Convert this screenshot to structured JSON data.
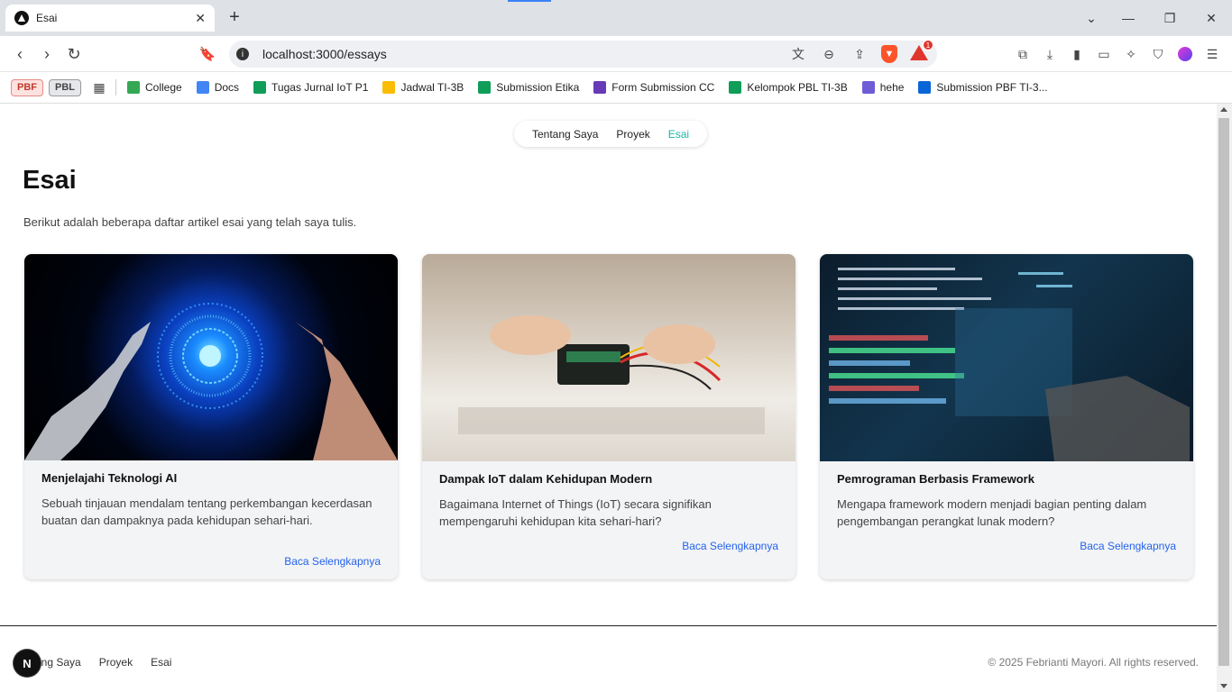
{
  "browser": {
    "tab_title": "Esai",
    "url": "localhost:3000/essays",
    "bookmarks": [
      {
        "label": "College",
        "icon": "google-drive-icon",
        "color": "#34a853"
      },
      {
        "label": "Docs",
        "icon": "google-docs-icon",
        "color": "#4285f4"
      },
      {
        "label": "Tugas Jurnal IoT P1",
        "icon": "google-sheets-icon",
        "color": "#0f9d58"
      },
      {
        "label": "Jadwal TI-3B",
        "icon": "google-drive-icon",
        "color": "#fbbc04"
      },
      {
        "label": "Submission Etika",
        "icon": "google-sheets-icon",
        "color": "#0f9d58"
      },
      {
        "label": "Form Submission CC",
        "icon": "google-forms-icon",
        "color": "#673ab7"
      },
      {
        "label": "Kelompok PBL TI-3B",
        "icon": "google-sheets-icon",
        "color": "#0f9d58"
      },
      {
        "label": "hehe",
        "icon": "q-icon",
        "color": "#6d5cd6"
      },
      {
        "label": "Submission PBF TI-3...",
        "icon": "onedrive-icon",
        "color": "#0a66d6"
      }
    ],
    "pills": [
      "PBF",
      "PBL"
    ],
    "notification_count": "1"
  },
  "nav": {
    "items": [
      "Tentang Saya",
      "Proyek",
      "Esai"
    ],
    "active": "Esai"
  },
  "page": {
    "title": "Esai",
    "subtitle": "Berikut adalah beberapa daftar artikel esai yang telah saya tulis."
  },
  "cards": [
    {
      "title": "Menjelajahi Teknologi AI",
      "desc": "Sebuah tinjauan mendalam tentang perkembangan kecerdasan buatan dan dampaknya pada kehidupan sehari-hari.",
      "link": "Baca Selengkapnya"
    },
    {
      "title": "Dampak IoT dalam Kehidupan Modern",
      "desc": "Bagaimana Internet of Things (IoT) secara signifikan mempengaruhi kehidupan kita sehari-hari?",
      "link": "Baca Selengkapnya"
    },
    {
      "title": "Pemrograman Berbasis Framework",
      "desc": "Mengapa framework modern menjadi bagian penting dalam pengembangan perangkat lunak modern?",
      "link": "Baca Selengkapnya"
    }
  ],
  "footer": {
    "items": [
      "Tentang Saya",
      "Proyek",
      "Esai"
    ],
    "visible_first": "ang Saya",
    "copyright": "© 2025 Febrianti Mayori. All rights reserved."
  },
  "dev_badge": "N",
  "colors": {
    "accent": "#14b8a6",
    "link": "#2563eb"
  }
}
